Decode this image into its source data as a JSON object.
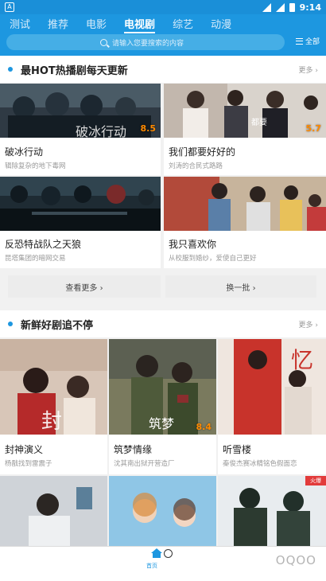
{
  "status": {
    "time": "9:14",
    "left_icon": "A"
  },
  "tabs": [
    {
      "label": "测试",
      "active": false
    },
    {
      "label": "推荐",
      "active": false
    },
    {
      "label": "电影",
      "active": false
    },
    {
      "label": "电视剧",
      "active": true
    },
    {
      "label": "综艺",
      "active": false
    },
    {
      "label": "动漫",
      "active": false
    }
  ],
  "search": {
    "placeholder": "请输入您要搜索的内容",
    "all_label": "全部"
  },
  "section1": {
    "title": "最HOT热播剧每天更新",
    "more": "更多 ›",
    "cards": [
      {
        "title": "破冰行动",
        "subtitle": "辑除复杂的地下毒网",
        "score": "8.5",
        "poster_text": "破冰行动"
      },
      {
        "title": "我们都要好好的",
        "subtitle": "刘涛的合民式路路",
        "score": "5.7",
        "poster_text": "都要"
      },
      {
        "title": "反恐特战队之天狼",
        "subtitle": "昆塔集团的暗网交易",
        "score": "",
        "poster_text": ""
      },
      {
        "title": "我只喜欢你",
        "subtitle": "从校服到婚纱，爱使自己更好",
        "score": "",
        "poster_text": ""
      }
    ],
    "btn_more": "查看更多 ›",
    "btn_refresh": "换一批 ›"
  },
  "section2": {
    "title": "新鲜好剧追不停",
    "more": "更多 ›",
    "cards": [
      {
        "title": "封神演义",
        "subtitle": "杨戬找到雷震子",
        "score": "",
        "poster_text": "封"
      },
      {
        "title": "筑梦情缘",
        "subtitle": "沈其南出狱开营造厂",
        "score": "8.4",
        "poster_text": "筑梦"
      },
      {
        "title": "听雪楼",
        "subtitle": "秦俊杰赛冰精铭色假面恋",
        "score": "",
        "poster_text": "忆"
      }
    ],
    "row2_badge": "火爆"
  },
  "nav": {
    "label": "首页"
  },
  "watermark": "OQOO",
  "colors": {
    "accent": "#1d97e0",
    "score": "#ff8a00"
  }
}
